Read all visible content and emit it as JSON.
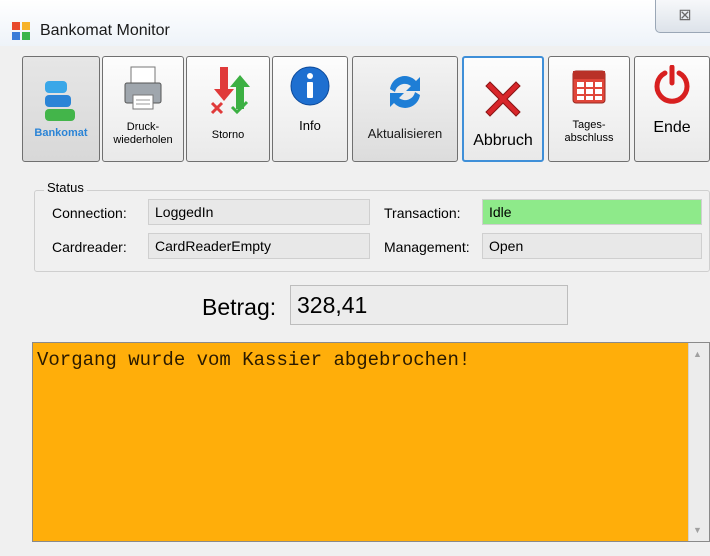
{
  "window": {
    "title": "Bankomat Monitor",
    "close_glyph": "⊠",
    "close_label": "X"
  },
  "toolbar": [
    {
      "id": "bankomat",
      "label": "Bankomat",
      "icon": "bankomat-logo-icon",
      "color": "#2b84d6"
    },
    {
      "id": "druck",
      "label": "Druck-\nwiederholen",
      "icon": "printer-icon"
    },
    {
      "id": "storno",
      "label": "Storno",
      "icon": "storno-arrows-icon"
    },
    {
      "id": "info",
      "label": "Info",
      "icon": "info-icon"
    },
    {
      "id": "aktualisieren",
      "label": "Aktualisieren",
      "icon": "refresh-icon"
    },
    {
      "id": "abbruch",
      "label": "Abbruch",
      "icon": "cancel-x-icon"
    },
    {
      "id": "tagesabschluss",
      "label": "Tages-\nabschluss",
      "icon": "calendar-icon"
    },
    {
      "id": "ende",
      "label": "Ende",
      "icon": "power-icon"
    }
  ],
  "status": {
    "legend": "Status",
    "connection": {
      "label": "Connection:",
      "value": "LoggedIn"
    },
    "cardreader": {
      "label": "Cardreader:",
      "value": "CardReaderEmpty"
    },
    "transaction": {
      "label": "Transaction:",
      "value": "Idle",
      "color": "#8eea8a"
    },
    "management": {
      "label": "Management:",
      "value": "Open"
    }
  },
  "betrag": {
    "label": "Betrag:",
    "value": "328,41"
  },
  "message": {
    "text": "Vorgang wurde vom Kassier abgebrochen!",
    "background": "#ffae0a"
  },
  "colors": {
    "accent": "#3f8fd8",
    "cancel_red": "#d8262a",
    "calendar_red": "#e0463a",
    "power_red": "#d82020"
  }
}
